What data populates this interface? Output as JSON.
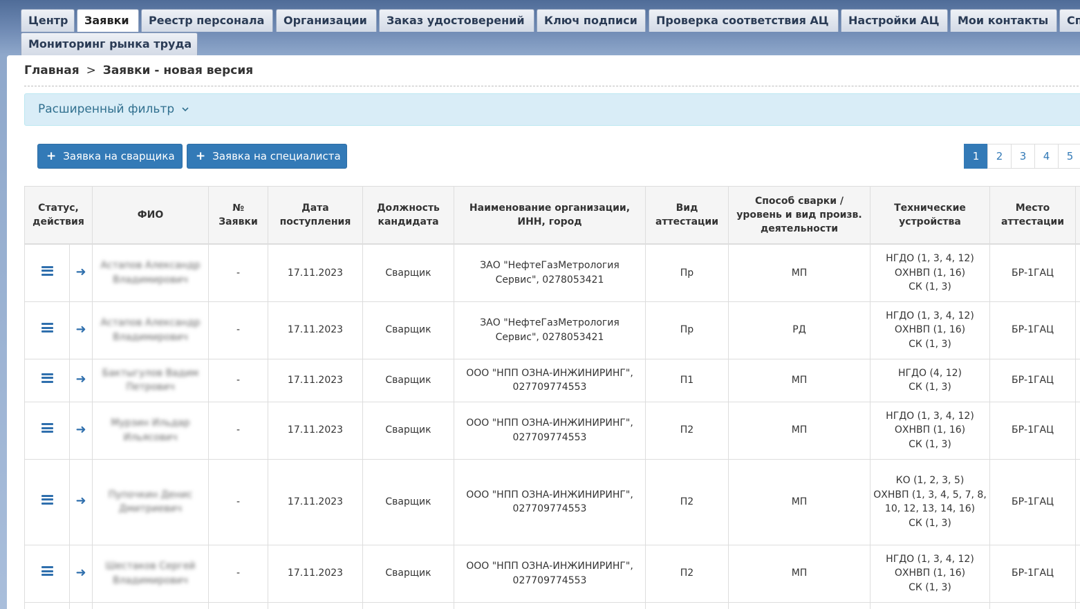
{
  "tabs": [
    "Центр",
    "Заявки",
    "Реестр персонала",
    "Организации",
    "Заказ удостоверений",
    "Ключ подписи",
    "Проверка соответствия АЦ",
    "Настройки АЦ",
    "Мои контакты",
    "Сп",
    "Мониторинг рынка труда"
  ],
  "breadcrumb": {
    "home": "Главная",
    "separator": ">",
    "current": "Заявки - новая версия"
  },
  "filter": {
    "label": "Расширенный фильтр",
    "icon": "chevron-down-icon"
  },
  "buttons": {
    "welder": "Заявка на сварщика",
    "specialist": "Заявка на специалиста",
    "plus_icon": "+"
  },
  "pagination": [
    "1",
    "2",
    "3",
    "4",
    "5"
  ],
  "table": {
    "headers": [
      "Статус, действия",
      "ФИО",
      "№ Заявки",
      "Дата поступления",
      "Должность кандидата",
      "Наименование организации, ИНН, город",
      "Вид аттестации",
      "Способ сварки / уровень и вид произв. деятельности",
      "Технические устройства",
      "Место аттестации"
    ],
    "rows": [
      {
        "fio": "Астапов Александр Владимирович",
        "number": "-",
        "date": "17.11.2023",
        "position": "Сварщик",
        "org": "ЗАО \"НефтеГазМетрология Сервис\", 0278053421",
        "type": "Пр",
        "method": "МП",
        "devices": [
          "НГДО (1, 3, 4, 12)",
          "ОХНВП (1, 16)",
          "СК (1, 3)"
        ],
        "place": "БР-1ГАЦ"
      },
      {
        "fio": "Астапов Александр Владимирович",
        "number": "-",
        "date": "17.11.2023",
        "position": "Сварщик",
        "org": "ЗАО \"НефтеГазМетрология Сервис\", 0278053421",
        "type": "Пр",
        "method": "РД",
        "devices": [
          "НГДО (1, 3, 4, 12)",
          "ОХНВП (1, 16)",
          "СК (1, 3)"
        ],
        "place": "БР-1ГАЦ"
      },
      {
        "fio": "Бактыгулов Вадим Петрович",
        "number": "-",
        "date": "17.11.2023",
        "position": "Сварщик",
        "org": "ООО \"НПП ОЗНА-ИНЖИНИРИНГ\", 027709774553",
        "type": "П1",
        "method": "МП",
        "devices": [
          "НГДО (4, 12)",
          "СК (1, 3)"
        ],
        "place": "БР-1ГАЦ"
      },
      {
        "fio": "Мурзин Ильдар Ильясович",
        "number": "-",
        "date": "17.11.2023",
        "position": "Сварщик",
        "org": "ООО \"НПП ОЗНА-ИНЖИНИРИНГ\", 027709774553",
        "type": "П2",
        "method": "МП",
        "devices": [
          "НГДО (1, 3, 4, 12)",
          "ОХНВП (1, 16)",
          "СК (1, 3)"
        ],
        "place": "БР-1ГАЦ"
      },
      {
        "fio": "Пупочкин Денис Дмитриевич",
        "number": "-",
        "date": "17.11.2023",
        "position": "Сварщик",
        "org": "ООО \"НПП ОЗНА-ИНЖИНИРИНГ\", 027709774553",
        "type": "П2",
        "method": "МП",
        "devices": [
          "КО (1, 2, 3, 5)",
          "ОХНВП (1, 3, 4, 5, 7, 8, 10, 12, 13, 14, 16)",
          "СК (1, 3)"
        ],
        "place": "БР-1ГАЦ"
      },
      {
        "fio": "Шестаков Сергей Владимирович",
        "number": "-",
        "date": "17.11.2023",
        "position": "Сварщик",
        "org": "ООО \"НПП ОЗНА-ИНЖИНИРИНГ\", 027709774553",
        "type": "П2",
        "method": "МП",
        "devices": [
          "НГДО (1, 3, 4, 12)",
          "ОХНВП (1, 16)",
          "СК (1, 3)"
        ],
        "place": "БР-1ГАЦ"
      }
    ]
  },
  "colors": {
    "accent": "#337ab7",
    "filter_bg": "#d9edf7",
    "filter_text": "#31708f",
    "tab_bar": "#6d88b2"
  }
}
